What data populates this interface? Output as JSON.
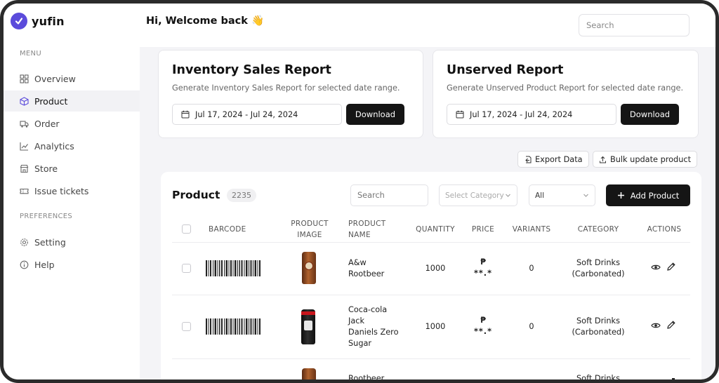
{
  "app": {
    "name": "yufin"
  },
  "sidebar": {
    "menu_label": "MENU",
    "items": [
      {
        "label": "Overview",
        "icon": "grid-icon"
      },
      {
        "label": "Product",
        "icon": "cube-icon",
        "active": true
      },
      {
        "label": "Order",
        "icon": "truck-icon"
      },
      {
        "label": "Analytics",
        "icon": "chart-icon"
      },
      {
        "label": "Store",
        "icon": "store-icon"
      },
      {
        "label": "Issue tickets",
        "icon": "ticket-icon"
      }
    ],
    "preferences_label": "PREFERENCES",
    "pref_items": [
      {
        "label": "Setting",
        "icon": "gear-icon"
      },
      {
        "label": "Help",
        "icon": "info-icon"
      }
    ]
  },
  "header": {
    "greeting": "Hi, Welcome back 👋",
    "search_placeholder": "Search"
  },
  "reports": [
    {
      "title": "Inventory Sales Report",
      "subtitle": "Generate Inventory Sales Report for selected date range.",
      "date_range": "Jul 17, 2024 - Jul 24, 2024",
      "button": "Download"
    },
    {
      "title": "Unserved Report",
      "subtitle": "Generate Unserved Product Report for selected date range.",
      "date_range": "Jul 17, 2024 - Jul 24, 2024",
      "button": "Download"
    }
  ],
  "actions": {
    "export": "Export Data",
    "bulk": "Bulk update product"
  },
  "products": {
    "title": "Product",
    "count": "2235",
    "search_placeholder": "Search",
    "category_placeholder": "Select Category",
    "filter_value": "All",
    "add_button": "Add Product",
    "columns": {
      "barcode": "BARCODE",
      "image_1": "PRODUCT",
      "image_2": "IMAGE",
      "name_1": "PRODUCT",
      "name_2": "NAME",
      "quantity": "QUANTITY",
      "price": "PRICE",
      "variants": "VARIANTS",
      "category": "CATEGORY",
      "actions": "ACTIONS"
    },
    "rows": [
      {
        "name_lines": [
          "A&w",
          "Rootbeer"
        ],
        "quantity": "1000",
        "price_symbol": "₱",
        "price_masked": "**.*",
        "variants": "0",
        "category_lines": [
          "Soft Drinks",
          "(Carbonated)"
        ]
      },
      {
        "name_lines": [
          "Coca-cola",
          "Jack",
          "Daniels Zero",
          "Sugar"
        ],
        "quantity": "1000",
        "price_symbol": "₱",
        "price_masked": "**.*",
        "variants": "0",
        "category_lines": [
          "Soft Drinks",
          "(Carbonated)"
        ]
      },
      {
        "name_lines": [
          "Rootbeer"
        ],
        "category_lines": [
          "Soft Drinks"
        ]
      }
    ]
  }
}
